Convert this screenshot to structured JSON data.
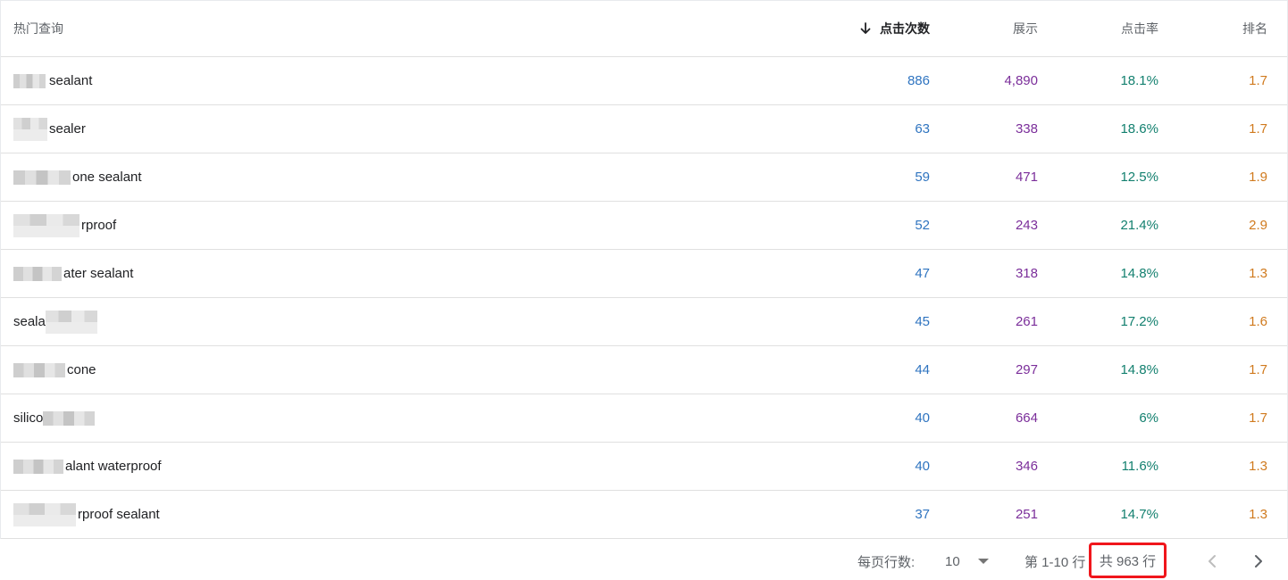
{
  "table": {
    "headers": {
      "query": "热门查询",
      "clicks": "点击次数",
      "impressions": "展示",
      "ctr": "点击率",
      "position": "排名"
    },
    "rows": [
      {
        "query": "sealant",
        "clicks": "886",
        "impressions": "4,890",
        "ctr": "18.1%",
        "position": "1.7"
      },
      {
        "query": "sealer",
        "clicks": "63",
        "impressions": "338",
        "ctr": "18.6%",
        "position": "1.7"
      },
      {
        "query": "one sealant",
        "clicks": "59",
        "impressions": "471",
        "ctr": "12.5%",
        "position": "1.9"
      },
      {
        "query": "rproof",
        "clicks": "52",
        "impressions": "243",
        "ctr": "21.4%",
        "position": "2.9"
      },
      {
        "query": "ater sealant",
        "clicks": "47",
        "impressions": "318",
        "ctr": "14.8%",
        "position": "1.3"
      },
      {
        "query": "seala",
        "clicks": "45",
        "impressions": "261",
        "ctr": "17.2%",
        "position": "1.6"
      },
      {
        "query": "cone",
        "clicks": "44",
        "impressions": "297",
        "ctr": "14.8%",
        "position": "1.7"
      },
      {
        "query": "silico",
        "clicks": "40",
        "impressions": "664",
        "ctr": "6%",
        "position": "1.7"
      },
      {
        "query": "alant waterproof",
        "clicks": "40",
        "impressions": "346",
        "ctr": "11.6%",
        "position": "1.3"
      },
      {
        "query": "rproof sealant",
        "clicks": "37",
        "impressions": "251",
        "ctr": "14.7%",
        "position": "1.3"
      }
    ]
  },
  "pagination": {
    "rows_per_page_label": "每页行数:",
    "rows_per_page_value": "10",
    "range_label": "第 1-10 行",
    "total_label": "共 963 行"
  },
  "colors": {
    "clicks": "#2f74c0",
    "impressions": "#7b2e9a",
    "ctr": "#13806f",
    "position": "#d07a1e",
    "highlight_box": "#f0161c"
  },
  "icons": {
    "sort": "arrow-down-icon",
    "rows_dropdown": "caret-down-icon",
    "prev": "chevron-left-icon",
    "next": "chevron-right-icon"
  }
}
